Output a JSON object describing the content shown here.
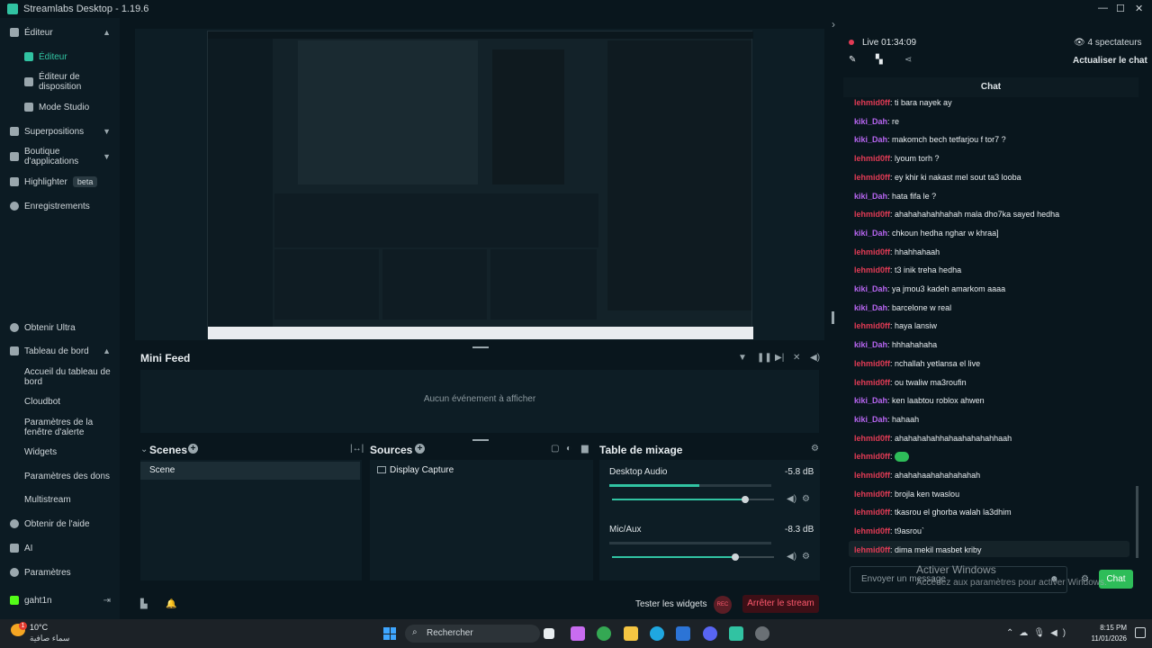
{
  "window": {
    "title": "Streamlabs Desktop - 1.19.6"
  },
  "sidebar": {
    "editor_section": "Éditeur",
    "editor_items": [
      "Éditeur",
      "Éditeur de disposition",
      "Mode Studio"
    ],
    "superpositions": "Superpositions",
    "app_store": "Boutique d'applications",
    "highlighter": "Highlighter",
    "highlighter_badge": "beta",
    "recordings": "Enregistrements",
    "ultra": "Obtenir Ultra",
    "dashboard": "Tableau de bord",
    "dashboard_items": [
      "Accueil du tableau de bord",
      "Cloudbot",
      "Paramètres de la fenêtre d'alerte",
      "Widgets",
      "Paramètres des dons",
      "Multistream"
    ],
    "help": "Obtenir de l'aide",
    "ai": "AI",
    "settings": "Paramètres",
    "user": "gaht1n"
  },
  "minifeed": {
    "title": "Mini Feed",
    "empty": "Aucun événement à afficher"
  },
  "scenes": {
    "title": "Scenes",
    "items": [
      "Scene"
    ]
  },
  "sources": {
    "title": "Sources",
    "items": [
      "Display Capture"
    ]
  },
  "mixer": {
    "title": "Table de mixage",
    "channels": [
      {
        "name": "Desktop Audio",
        "db": "-5.8 dB",
        "level": 0.82
      },
      {
        "name": "Mic/Aux",
        "db": "-8.3 dB",
        "level": 0.76
      }
    ]
  },
  "footer": {
    "test_widgets": "Tester les widgets",
    "rec": "REC",
    "stop": "Arrêter le stream"
  },
  "stream": {
    "status": "Live",
    "time": "01:34:09",
    "viewers": "4 spectateurs",
    "refresh": "Actualiser le chat"
  },
  "chat": {
    "header": "Chat",
    "messages": [
      {
        "user": "lehmid0ff",
        "text": "ti bara nayek ay"
      },
      {
        "user": "kiki_Dah",
        "text": "re"
      },
      {
        "user": "kiki_Dah",
        "text": "makomch bech tetfarjou f tor7 ?"
      },
      {
        "user": "lehmid0ff",
        "text": "lyoum torh ?"
      },
      {
        "user": "lehmid0ff",
        "text": "ey khir ki nakast mel sout ta3 looba"
      },
      {
        "user": "kiki_Dah",
        "text": "hata fifa le ?"
      },
      {
        "user": "lehmid0ff",
        "text": "ahahahahahhahah mala dho7ka sayed hedha"
      },
      {
        "user": "kiki_Dah",
        "text": "chkoun hedha nghar w khraa]"
      },
      {
        "user": "lehmid0ff",
        "text": "hhahhahaah"
      },
      {
        "user": "lehmid0ff",
        "text": "t3 inik treha hedha"
      },
      {
        "user": "kiki_Dah",
        "text": "ya jmou3 kadeh amarkom aaaa"
      },
      {
        "user": "kiki_Dah",
        "text": "barcelone w real"
      },
      {
        "user": "lehmid0ff",
        "text": "haya lansiw"
      },
      {
        "user": "kiki_Dah",
        "text": "hhhahahaha"
      },
      {
        "user": "lehmid0ff",
        "text": "nchallah yetlansa el live"
      },
      {
        "user": "lehmid0ff",
        "text": "ou twaliw ma3roufin"
      },
      {
        "user": "kiki_Dah",
        "text": "ken laabtou roblox ahwen"
      },
      {
        "user": "kiki_Dah",
        "text": "hahaah"
      },
      {
        "user": "lehmid0ff",
        "text": "ahahahahahhahaahahahahhaah"
      },
      {
        "user": "lehmid0ff",
        "text": ""
      },
      {
        "user": "lehmid0ff",
        "text": "ahahahaahahahahahah"
      },
      {
        "user": "lehmid0ff",
        "text": "brojla ken twaslou"
      },
      {
        "user": "lehmid0ff",
        "text": "tkasrou el ghorba walah la3dhim"
      },
      {
        "user": "lehmid0ff",
        "text": "t9asrou`"
      },
      {
        "user": "lehmid0ff",
        "text": "dima mekil masbet kriby"
      }
    ],
    "input_placeholder": "Envoyer un message",
    "send": "Chat"
  },
  "watermark": {
    "line1": "Activer Windows",
    "line2": "Accédez aux paramètres pour activer Windows."
  },
  "taskbar": {
    "weather_temp": "10°C",
    "weather_desc": "سماء صافية",
    "search": "Rechercher",
    "time": "8:15 PM",
    "date": "11/01/2026",
    "notification_count": "1"
  }
}
